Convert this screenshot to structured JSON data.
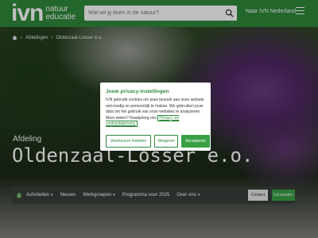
{
  "header": {
    "logo_main": "ivn",
    "logo_line1": "natuur",
    "logo_line2": "educatie",
    "search_placeholder": "Wat wil jij doen in de natuur?",
    "nav_link": "Naar IVN Nederland",
    "colors": {
      "brand_green": "#2f8a3b"
    }
  },
  "breadcrumb": {
    "items": [
      "Afdelingen",
      "Oldenzaal-Losser e.o."
    ]
  },
  "hero": {
    "label": "Afdeling",
    "title": "Oldenzaal-Losser e.o."
  },
  "tabs": {
    "items": [
      {
        "label": "Activiteiten",
        "chevron": true
      },
      {
        "label": "Nieuws",
        "chevron": false
      },
      {
        "label": "Werkgroepen",
        "chevron": true
      },
      {
        "label": "Programma voor 2025",
        "chevron": false
      },
      {
        "label": "Over ons",
        "chevron": true
      }
    ],
    "contact_label": "Contact",
    "join_label": "Lid worden"
  },
  "cookie_modal": {
    "title": "Jouw privacy-instellingen",
    "body": "IVN gebruikt cookies om jouw bezoek aan onze website eenvoudig en persoonlijk te maken. We gebruiken jouw data om het gebruik van onze websites te analyseren. Meer weten? Raadpleeg ons",
    "link_text": "Privacy- en cookiestatement.",
    "btn_settings": "Voorkeuren instellen",
    "btn_reject": "Weigeren",
    "btn_accept": "Accepteren"
  }
}
